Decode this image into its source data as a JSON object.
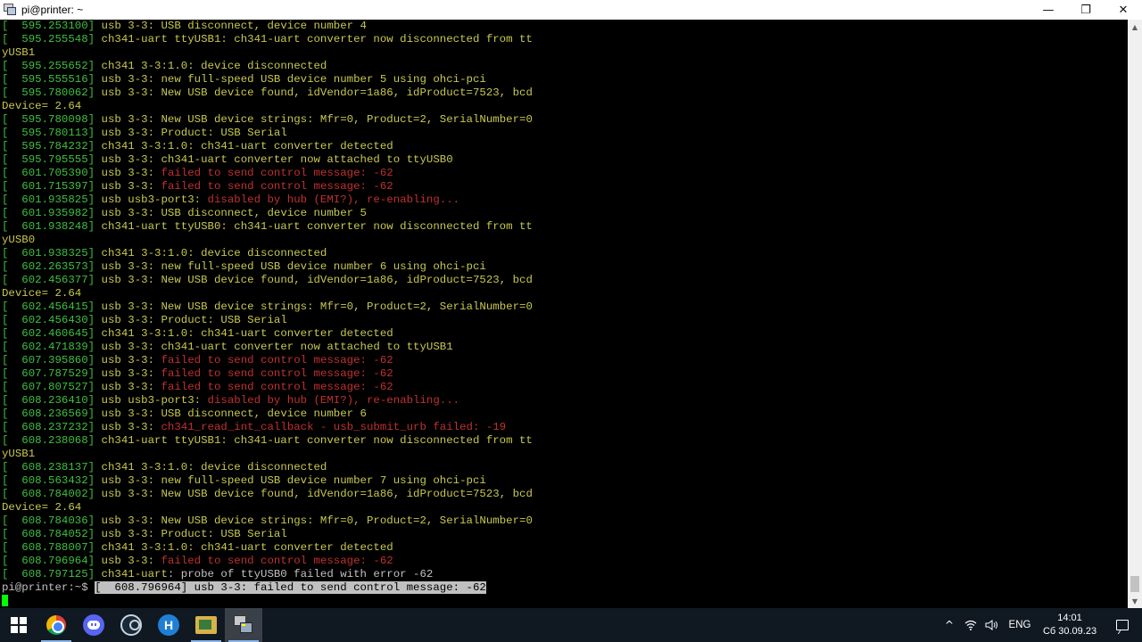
{
  "window": {
    "title": "pi@printer: ~",
    "minimize_glyph": "—",
    "restore_glyph": "❐",
    "close_glyph": "✕"
  },
  "terminal": {
    "lines": [
      [
        {
          "t": "[  595.253100] ",
          "c": "ts"
        },
        {
          "t": "usb 3-3",
          "c": "dev"
        },
        {
          "t": ": USB disconnect, device number 4",
          "c": "dev"
        }
      ],
      [
        {
          "t": "[  595.255548] ",
          "c": "ts"
        },
        {
          "t": "ch341-uart ttyUSB1",
          "c": "dev"
        },
        {
          "t": ": ch341-uart converter now disconnected from tt",
          "c": "dev"
        }
      ],
      [
        {
          "t": "yUSB1",
          "c": "dev"
        }
      ],
      [
        {
          "t": "[  595.255652] ",
          "c": "ts"
        },
        {
          "t": "ch341 3-3:1.0",
          "c": "dev"
        },
        {
          "t": ": device disconnected",
          "c": "dev"
        }
      ],
      [
        {
          "t": "[  595.555516] ",
          "c": "ts"
        },
        {
          "t": "usb 3-3",
          "c": "dev"
        },
        {
          "t": ": new full-speed USB device number 5 using ohci-pci",
          "c": "dev"
        }
      ],
      [
        {
          "t": "[  595.780062] ",
          "c": "ts"
        },
        {
          "t": "usb 3-3",
          "c": "dev"
        },
        {
          "t": ": New USB device found, idVendor=1a86, idProduct=7523, bcd",
          "c": "dev"
        }
      ],
      [
        {
          "t": "Device= 2.64",
          "c": "dev"
        }
      ],
      [
        {
          "t": "[  595.780098] ",
          "c": "ts"
        },
        {
          "t": "usb 3-3",
          "c": "dev"
        },
        {
          "t": ": New USB device strings: Mfr=0, Product=2, SerialNumber=0",
          "c": "dev"
        }
      ],
      [
        {
          "t": "[  595.780113] ",
          "c": "ts"
        },
        {
          "t": "usb 3-3",
          "c": "dev"
        },
        {
          "t": ": Product: USB Serial",
          "c": "dev"
        }
      ],
      [
        {
          "t": "[  595.784232] ",
          "c": "ts"
        },
        {
          "t": "ch341 3-3:1.0",
          "c": "dev"
        },
        {
          "t": ": ch341-uart converter detected",
          "c": "dev"
        }
      ],
      [
        {
          "t": "[  595.795555] ",
          "c": "ts"
        },
        {
          "t": "usb 3-3",
          "c": "dev"
        },
        {
          "t": ": ch341-uart converter now attached to ttyUSB0",
          "c": "dev"
        }
      ],
      [
        {
          "t": "[  601.705390] ",
          "c": "ts"
        },
        {
          "t": "usb 3-3",
          "c": "dev"
        },
        {
          "t": ": ",
          "c": "dev"
        },
        {
          "t": "failed to send control message: -62",
          "c": "err"
        }
      ],
      [
        {
          "t": "[  601.715397] ",
          "c": "ts"
        },
        {
          "t": "usb 3-3",
          "c": "dev"
        },
        {
          "t": ": ",
          "c": "dev"
        },
        {
          "t": "failed to send control message: -62",
          "c": "err"
        }
      ],
      [
        {
          "t": "[  601.935825] ",
          "c": "ts"
        },
        {
          "t": "usb usb3-port3",
          "c": "dev"
        },
        {
          "t": ": ",
          "c": "dev"
        },
        {
          "t": "disabled by hub (EMI?), re-enabling...",
          "c": "err"
        }
      ],
      [
        {
          "t": "[  601.935982] ",
          "c": "ts"
        },
        {
          "t": "usb 3-3",
          "c": "dev"
        },
        {
          "t": ": USB disconnect, device number 5",
          "c": "dev"
        }
      ],
      [
        {
          "t": "[  601.938248] ",
          "c": "ts"
        },
        {
          "t": "ch341-uart ttyUSB0",
          "c": "dev"
        },
        {
          "t": ": ch341-uart converter now disconnected from tt",
          "c": "dev"
        }
      ],
      [
        {
          "t": "yUSB0",
          "c": "dev"
        }
      ],
      [
        {
          "t": "[  601.938325] ",
          "c": "ts"
        },
        {
          "t": "ch341 3-3:1.0",
          "c": "dev"
        },
        {
          "t": ": device disconnected",
          "c": "dev"
        }
      ],
      [
        {
          "t": "[  602.263573] ",
          "c": "ts"
        },
        {
          "t": "usb 3-3",
          "c": "dev"
        },
        {
          "t": ": new full-speed USB device number 6 using ohci-pci",
          "c": "dev"
        }
      ],
      [
        {
          "t": "[  602.456377] ",
          "c": "ts"
        },
        {
          "t": "usb 3-3",
          "c": "dev"
        },
        {
          "t": ": New USB device found, idVendor=1a86, idProduct=7523, bcd",
          "c": "dev"
        }
      ],
      [
        {
          "t": "Device= 2.64",
          "c": "dev"
        }
      ],
      [
        {
          "t": "[  602.456415] ",
          "c": "ts"
        },
        {
          "t": "usb 3-3",
          "c": "dev"
        },
        {
          "t": ": New USB device strings: Mfr=0, Product=2, SerialNumber=0",
          "c": "dev"
        }
      ],
      [
        {
          "t": "[  602.456430] ",
          "c": "ts"
        },
        {
          "t": "usb 3-3",
          "c": "dev"
        },
        {
          "t": ": Product: USB Serial",
          "c": "dev"
        }
      ],
      [
        {
          "t": "[  602.460645] ",
          "c": "ts"
        },
        {
          "t": "ch341 3-3:1.0",
          "c": "dev"
        },
        {
          "t": ": ch341-uart converter detected",
          "c": "dev"
        }
      ],
      [
        {
          "t": "[  602.471839] ",
          "c": "ts"
        },
        {
          "t": "usb 3-3",
          "c": "dev"
        },
        {
          "t": ": ch341-uart converter now attached to ttyUSB1",
          "c": "dev"
        }
      ],
      [
        {
          "t": "[  607.395860] ",
          "c": "ts"
        },
        {
          "t": "usb 3-3",
          "c": "dev"
        },
        {
          "t": ": ",
          "c": "dev"
        },
        {
          "t": "failed to send control message: -62",
          "c": "err"
        }
      ],
      [
        {
          "t": "[  607.787529] ",
          "c": "ts"
        },
        {
          "t": "usb 3-3",
          "c": "dev"
        },
        {
          "t": ": ",
          "c": "dev"
        },
        {
          "t": "failed to send control message: -62",
          "c": "err"
        }
      ],
      [
        {
          "t": "[  607.807527] ",
          "c": "ts"
        },
        {
          "t": "usb 3-3",
          "c": "dev"
        },
        {
          "t": ": ",
          "c": "dev"
        },
        {
          "t": "failed to send control message: -62",
          "c": "err"
        }
      ],
      [
        {
          "t": "[  608.236410] ",
          "c": "ts"
        },
        {
          "t": "usb usb3-port3",
          "c": "dev"
        },
        {
          "t": ": ",
          "c": "dev"
        },
        {
          "t": "disabled by hub (EMI?), re-enabling...",
          "c": "err"
        }
      ],
      [
        {
          "t": "[  608.236569] ",
          "c": "ts"
        },
        {
          "t": "usb 3-3",
          "c": "dev"
        },
        {
          "t": ": USB disconnect, device number 6",
          "c": "dev"
        }
      ],
      [
        {
          "t": "[  608.237232] ",
          "c": "ts"
        },
        {
          "t": "usb 3-3",
          "c": "dev"
        },
        {
          "t": ": ",
          "c": "dev"
        },
        {
          "t": "ch341_read_int_callback - usb_submit_urb failed: -19",
          "c": "err"
        }
      ],
      [
        {
          "t": "[  608.238068] ",
          "c": "ts"
        },
        {
          "t": "ch341-uart ttyUSB1",
          "c": "dev"
        },
        {
          "t": ": ch341-uart converter now disconnected from tt",
          "c": "dev"
        }
      ],
      [
        {
          "t": "yUSB1",
          "c": "dev"
        }
      ],
      [
        {
          "t": "[  608.238137] ",
          "c": "ts"
        },
        {
          "t": "ch341 3-3:1.0",
          "c": "dev"
        },
        {
          "t": ": device disconnected",
          "c": "dev"
        }
      ],
      [
        {
          "t": "[  608.563432] ",
          "c": "ts"
        },
        {
          "t": "usb 3-3",
          "c": "dev"
        },
        {
          "t": ": new full-speed USB device number 7 using ohci-pci",
          "c": "dev"
        }
      ],
      [
        {
          "t": "[  608.784002] ",
          "c": "ts"
        },
        {
          "t": "usb 3-3",
          "c": "dev"
        },
        {
          "t": ": New USB device found, idVendor=1a86, idProduct=7523, bcd",
          "c": "dev"
        }
      ],
      [
        {
          "t": "Device= 2.64",
          "c": "dev"
        }
      ],
      [
        {
          "t": "[  608.784036] ",
          "c": "ts"
        },
        {
          "t": "usb 3-3",
          "c": "dev"
        },
        {
          "t": ": New USB device strings: Mfr=0, Product=2, SerialNumber=0",
          "c": "dev"
        }
      ],
      [
        {
          "t": "[  608.784052] ",
          "c": "ts"
        },
        {
          "t": "usb 3-3",
          "c": "dev"
        },
        {
          "t": ": Product: USB Serial",
          "c": "dev"
        }
      ],
      [
        {
          "t": "[  608.788007] ",
          "c": "ts"
        },
        {
          "t": "ch341 3-3:1.0",
          "c": "dev"
        },
        {
          "t": ": ch341-uart converter detected",
          "c": "dev"
        }
      ],
      [
        {
          "t": "[  608.796964] ",
          "c": "ts"
        },
        {
          "t": "usb 3-3",
          "c": "dev"
        },
        {
          "t": ": ",
          "c": "dev"
        },
        {
          "t": "failed to send control message: -62",
          "c": "err"
        }
      ],
      [
        {
          "t": "[  608.797125] ",
          "c": "ts"
        },
        {
          "t": "ch341-uart",
          "c": "dev"
        },
        {
          "t": ": probe of ttyUSB0 failed with error -62",
          "c": "prompt"
        }
      ]
    ],
    "prompt": "pi@printer:~$ ",
    "selected_text": "[  608.796964] usb 3-3: failed to send control message: -62"
  },
  "taskbar": {
    "apps": [
      {
        "name": "start-button",
        "icon": "windows-icon"
      },
      {
        "name": "taskbar-chrome",
        "icon": "chrome-icon"
      },
      {
        "name": "taskbar-discord",
        "icon": "discord-icon"
      },
      {
        "name": "taskbar-steam",
        "icon": "steam-icon"
      },
      {
        "name": "taskbar-autohotkey",
        "icon": "autohotkey-icon",
        "glyph": "H"
      },
      {
        "name": "taskbar-file-manager",
        "icon": "folder-icon"
      },
      {
        "name": "taskbar-putty",
        "icon": "putty-icon"
      }
    ],
    "tray": {
      "chevron": "^",
      "language": "ENG",
      "time": "14:01",
      "date": "Сб 30.09.23"
    }
  },
  "colors": {
    "timestamp": "#3fbf3f",
    "device": "#c8c850",
    "error": "#c03030",
    "cursor": "#00ff00"
  }
}
